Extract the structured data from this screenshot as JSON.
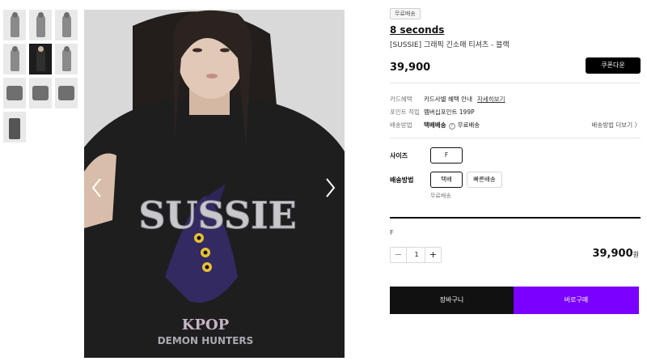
{
  "thumbnails": [
    {
      "name": "thumb-1",
      "style": "model"
    },
    {
      "name": "thumb-2",
      "style": "model"
    },
    {
      "name": "thumb-3",
      "style": "model"
    },
    {
      "name": "thumb-4",
      "style": "model"
    },
    {
      "name": "thumb-5",
      "style": "dark"
    },
    {
      "name": "thumb-6",
      "style": "model"
    },
    {
      "name": "thumb-7",
      "style": "flat"
    },
    {
      "name": "thumb-8",
      "style": "flat"
    },
    {
      "name": "thumb-9",
      "style": "flat"
    },
    {
      "name": "thumb-10",
      "style": "pants"
    }
  ],
  "main_image": {
    "shirt_text": "SUSSIE",
    "print_line1": "KPOP",
    "print_line2": "DEMON HUNTERS"
  },
  "product": {
    "badge": "무료배송",
    "brand": "8 seconds",
    "name": "[SUSSIE] 그래픽 긴소매 티셔츠 - 블랙",
    "price": "39,900",
    "coupon_label": "쿠폰다운"
  },
  "details": {
    "card_key": "카드혜택",
    "card_value": "카드사별 혜택 안내",
    "card_link": "자세히보기",
    "point_key": "포인트 적립",
    "point_value": "멤버십포인트 199P",
    "ship_key": "배송방법",
    "ship_value": "택배배송",
    "ship_help": "?",
    "ship_free": "무료배송",
    "ship_more": "배송방법 더보기"
  },
  "options": {
    "size_label": "사이즈",
    "size_value": "F",
    "delivery_label": "배송방법",
    "delivery_options": [
      "택배",
      "빠른배송"
    ],
    "delivery_note": "무료배송"
  },
  "order": {
    "selected_size": "F",
    "minus": "−",
    "plus": "+",
    "quantity": "1",
    "total": "39,900",
    "currency": "원",
    "cart_label": "장바구니",
    "buy_label": "바로구매"
  },
  "colors": {
    "buy_button": "#7a00ff",
    "cart_button": "#111111"
  }
}
